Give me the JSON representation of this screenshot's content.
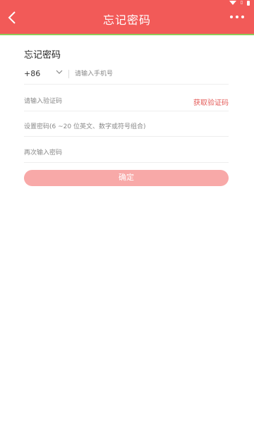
{
  "header": {
    "title": "忘记密码",
    "background_color": "#f25a58",
    "accent_line_color": "#8fc95a"
  },
  "form": {
    "heading": "忘记密码",
    "country_code": "+86",
    "phone_placeholder": "请输入手机号",
    "code_placeholder": "请输入验证码",
    "get_code_label": "获取验证码",
    "password_placeholder": "设置密码(6 ~20 位英文、数字或符号组合)",
    "password_confirm_placeholder": "再次输入密码",
    "confirm_label": "确定",
    "confirm_color": "#f8a9a8"
  }
}
